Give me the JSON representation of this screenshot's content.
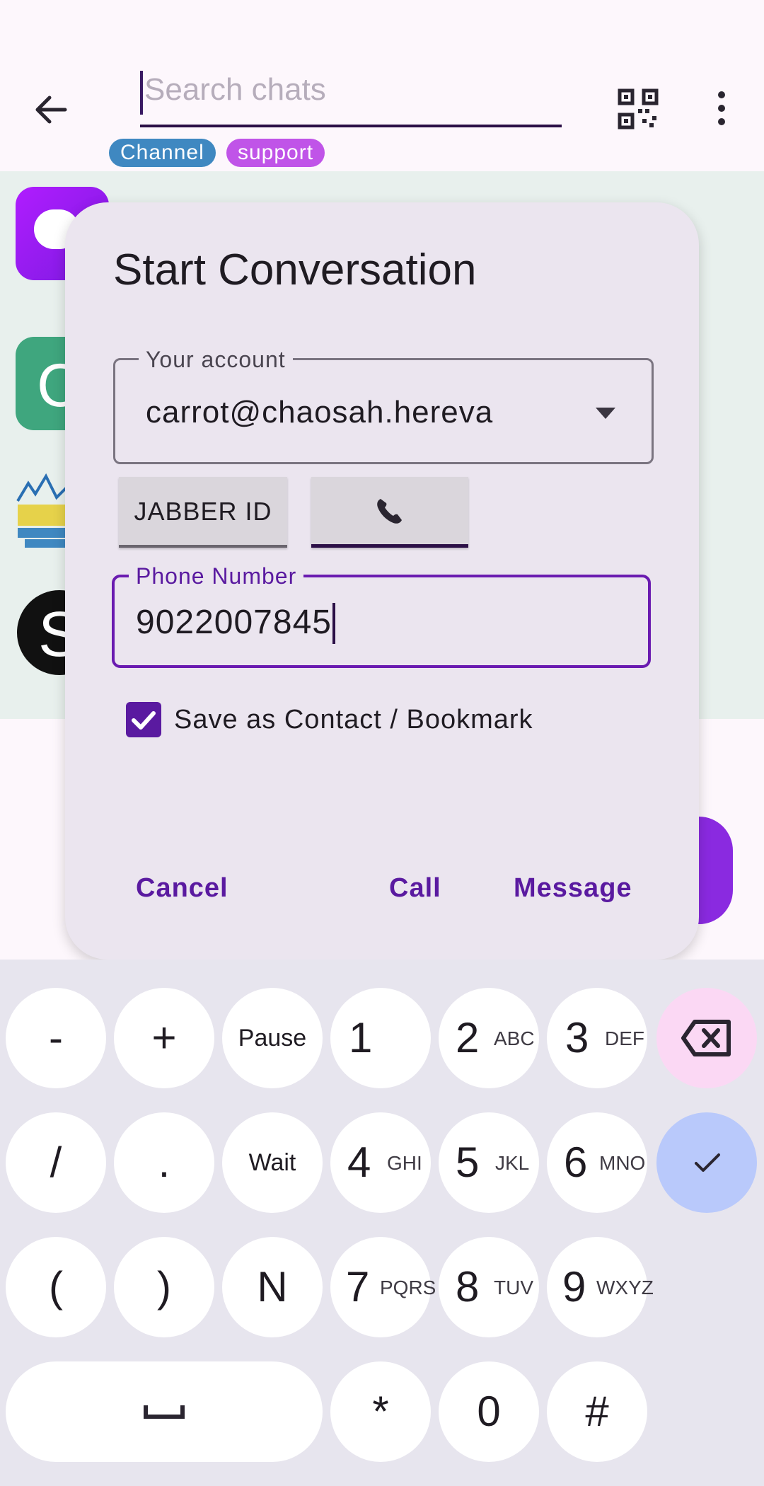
{
  "search": {
    "placeholder": "Search chats"
  },
  "chips": [
    "Channel",
    "support"
  ],
  "dialog": {
    "title": "Start Conversation",
    "account_label": "Your account",
    "account_value": "carrot@chaosah.hereva",
    "jabber_button": "JABBER ID",
    "phone_button_icon": "phone-icon",
    "phone_label": "Phone Number",
    "phone_value": "9022007845",
    "save_label": "Save as Contact / Bookmark",
    "save_checked": true,
    "cancel": "Cancel",
    "call": "Call",
    "message": "Message"
  },
  "list": {
    "avatar2_letter": "C",
    "avatar4_letter": "S"
  },
  "keypad": {
    "row1": [
      {
        "main": "-"
      },
      {
        "main": "+"
      },
      {
        "main": "Pause"
      },
      {
        "digit": "1",
        "sub": ""
      },
      {
        "digit": "2",
        "sub": "ABC"
      },
      {
        "digit": "3",
        "sub": "DEF"
      }
    ],
    "row2": [
      {
        "main": "/"
      },
      {
        "main": "."
      },
      {
        "main": "Wait"
      },
      {
        "digit": "4",
        "sub": "GHI"
      },
      {
        "digit": "5",
        "sub": "JKL"
      },
      {
        "digit": "6",
        "sub": "MNO"
      }
    ],
    "row3": [
      {
        "main": "("
      },
      {
        "main": ")"
      },
      {
        "main": "N"
      },
      {
        "digit": "7",
        "sub": "PQRS"
      },
      {
        "digit": "8",
        "sub": "TUV"
      },
      {
        "digit": "9",
        "sub": "WXYZ"
      }
    ],
    "row4": [
      {
        "main": "*"
      },
      {
        "main": "0"
      },
      {
        "main": "#"
      }
    ]
  },
  "colors": {
    "accent": "#5a1aa0",
    "backspace_bg": "#fbd8f4",
    "enter_bg": "#b9c9fb"
  }
}
